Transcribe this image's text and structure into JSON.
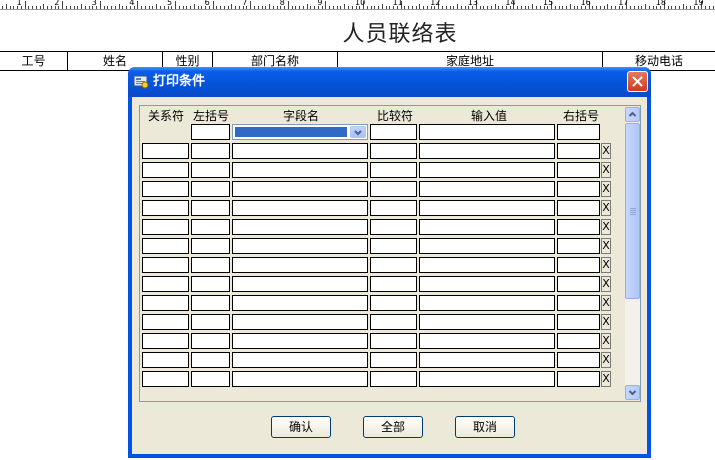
{
  "ruler": {
    "numbers": [
      "1",
      "2",
      "3",
      "4",
      "5",
      "6",
      "7",
      "8",
      "9",
      "10",
      "11",
      "12",
      "13",
      "14",
      "15",
      "16",
      "17",
      "18",
      "19"
    ]
  },
  "report": {
    "title": "人员联络表",
    "headers": [
      "工号",
      "姓名",
      "性别",
      "部门名称",
      "家庭地址",
      "移动电话"
    ]
  },
  "dialog": {
    "title": "打印条件",
    "columns": [
      "关系符",
      "左括号",
      "字段名",
      "比较符",
      "输入值",
      "右括号"
    ],
    "delete_glyph": "X",
    "row_count": 14,
    "buttons": {
      "confirm": "确认",
      "all": "全部",
      "cancel": "取消"
    }
  },
  "colors": {
    "title_bar": "#0054e3",
    "dialog_bg": "#ece9d8",
    "selection": "#316ac5",
    "close": "#d1391a"
  }
}
